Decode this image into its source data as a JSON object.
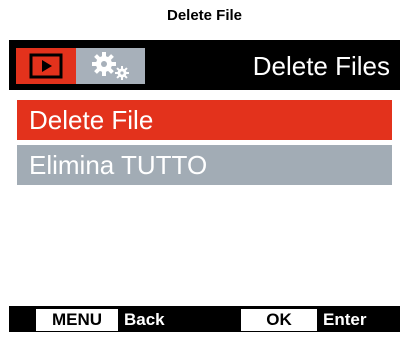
{
  "caption": "Delete File",
  "header": {
    "title": "Delete Files",
    "tabs": [
      {
        "icon": "playback-icon",
        "active": true
      },
      {
        "icon": "settings-gears-icon",
        "active": false
      }
    ]
  },
  "menu": {
    "items": [
      {
        "label": "Delete File",
        "selected": true
      },
      {
        "label": "Elimina TUTTO",
        "selected": false
      }
    ]
  },
  "footer": {
    "back_key": "MENU",
    "back_label": "Back",
    "enter_key": "OK",
    "enter_label": "Enter"
  },
  "colors": {
    "accent": "#e3321c",
    "inactive": "#a2acb5",
    "screen_bg": "#000000"
  }
}
